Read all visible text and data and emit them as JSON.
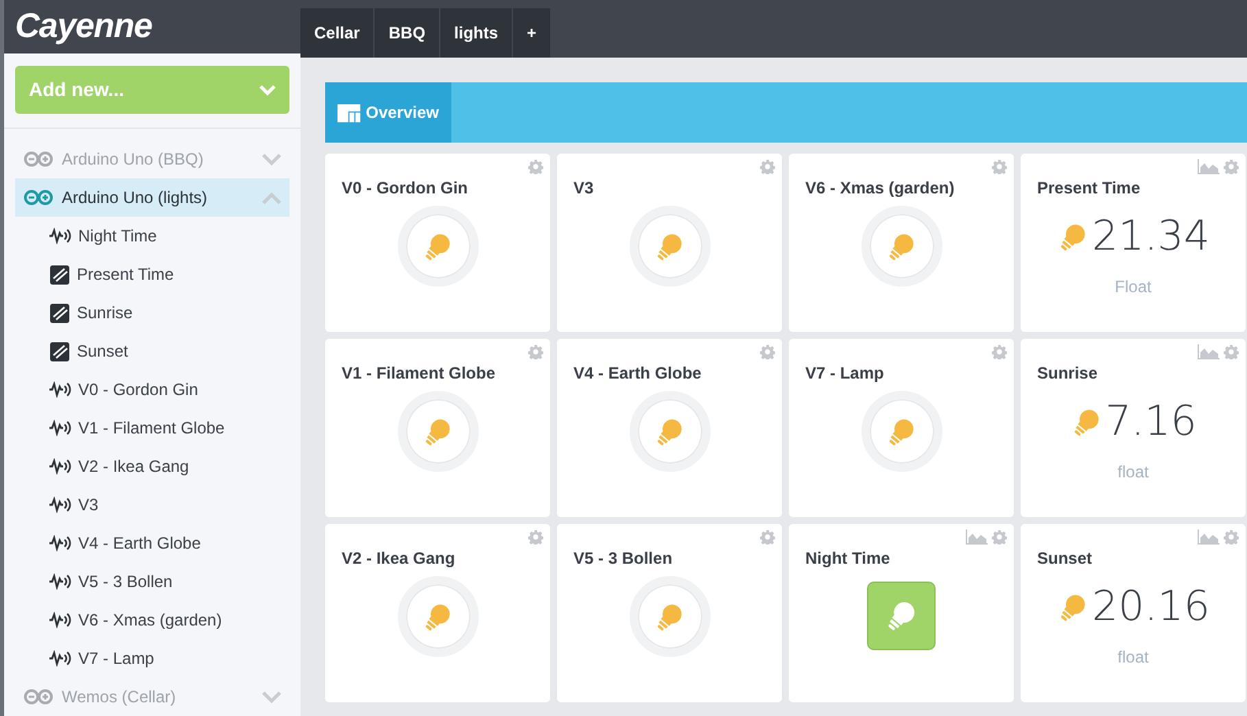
{
  "logo": "Cayenne",
  "tabs": [
    {
      "label": "Cellar"
    },
    {
      "label": "BBQ"
    },
    {
      "label": "lights"
    },
    {
      "label": "+"
    }
  ],
  "add_button": {
    "label": "Add new..."
  },
  "sidebar": {
    "devices": [
      {
        "name": "Arduino Uno (BBQ)",
        "expanded": false,
        "selected": false
      },
      {
        "name": "Arduino Uno (lights)",
        "expanded": true,
        "selected": true,
        "children": [
          {
            "label": "Night Time",
            "kind": "actuator"
          },
          {
            "label": "Present Time",
            "kind": "sensor"
          },
          {
            "label": "Sunrise",
            "kind": "sensor"
          },
          {
            "label": "Sunset",
            "kind": "sensor"
          },
          {
            "label": "V0 - Gordon Gin",
            "kind": "actuator"
          },
          {
            "label": "V1 - Filament Globe",
            "kind": "actuator"
          },
          {
            "label": "V2 - Ikea Gang",
            "kind": "actuator"
          },
          {
            "label": "V3",
            "kind": "actuator"
          },
          {
            "label": "V4 - Earth Globe",
            "kind": "actuator"
          },
          {
            "label": "V5 - 3 Bollen",
            "kind": "actuator"
          },
          {
            "label": "V6 - Xmas (garden)",
            "kind": "actuator"
          },
          {
            "label": "V7 - Lamp",
            "kind": "actuator"
          }
        ]
      },
      {
        "name": "Wemos (Cellar)",
        "expanded": false,
        "selected": false
      }
    ]
  },
  "overview_tab": {
    "label": "Overview"
  },
  "widgets": [
    {
      "title": "V0 - Gordon Gin",
      "kind": "button",
      "on": false,
      "chart_button": false
    },
    {
      "title": "V3",
      "kind": "button",
      "on": false,
      "chart_button": false
    },
    {
      "title": "V6 - Xmas (garden)",
      "kind": "button",
      "on": false,
      "chart_button": false
    },
    {
      "title": "Present Time",
      "kind": "value",
      "value": "21.34",
      "unit": "Float",
      "chart_button": true
    },
    {
      "title": "V1 - Filament Globe",
      "kind": "button",
      "on": false,
      "chart_button": false
    },
    {
      "title": "V4 - Earth Globe",
      "kind": "button",
      "on": false,
      "chart_button": false
    },
    {
      "title": "V7 - Lamp",
      "kind": "button",
      "on": false,
      "chart_button": false
    },
    {
      "title": "Sunrise",
      "kind": "value",
      "value": "7.16",
      "unit": "float",
      "chart_button": true
    },
    {
      "title": "V2 - Ikea Gang",
      "kind": "button",
      "on": false,
      "chart_button": false
    },
    {
      "title": "V5 - 3 Bollen",
      "kind": "button",
      "on": false,
      "chart_button": false
    },
    {
      "title": "Night Time",
      "kind": "button",
      "on": true,
      "chart_button": true
    },
    {
      "title": "Sunset",
      "kind": "value",
      "value": "20.16",
      "unit": "float",
      "chart_button": true
    }
  ]
}
